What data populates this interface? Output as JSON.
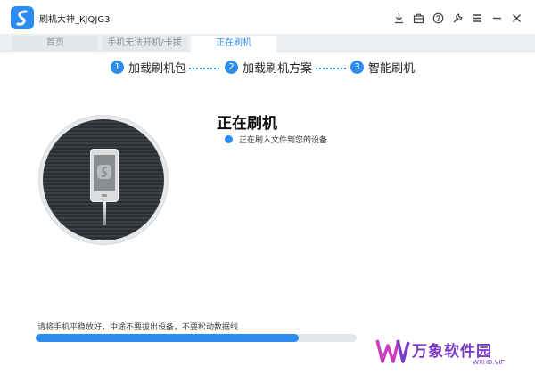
{
  "app": {
    "title": "刷机大神_KJQJG3"
  },
  "window_controls": [
    {
      "name": "download-icon"
    },
    {
      "name": "toolbox-icon"
    },
    {
      "name": "help-icon"
    },
    {
      "name": "wrench-icon"
    },
    {
      "name": "menu-icon"
    },
    {
      "name": "minimize-icon"
    },
    {
      "name": "close-icon"
    }
  ],
  "tabs": [
    {
      "label": "首页",
      "active": false
    },
    {
      "label": "手机无法开机/卡拔",
      "active": false
    },
    {
      "label": "正在刷机",
      "active": true
    }
  ],
  "steps": [
    {
      "num": "1",
      "label": "加载刷机包"
    },
    {
      "num": "2",
      "label": "加载刷机方案"
    },
    {
      "num": "3",
      "label": "智能刷机"
    }
  ],
  "status": {
    "title": "正在刷机",
    "detail": "正在刷入文件到您的设备"
  },
  "progress": {
    "hint": "请将手机平稳放好，中途不要拔出设备，不要松动数据线",
    "fraction": 0.82
  },
  "watermark": {
    "text": "万象软件园",
    "sub": "WXHD.VIP"
  },
  "colors": {
    "accent": "#2d8cf0",
    "watermark": "#7a3cc7"
  }
}
